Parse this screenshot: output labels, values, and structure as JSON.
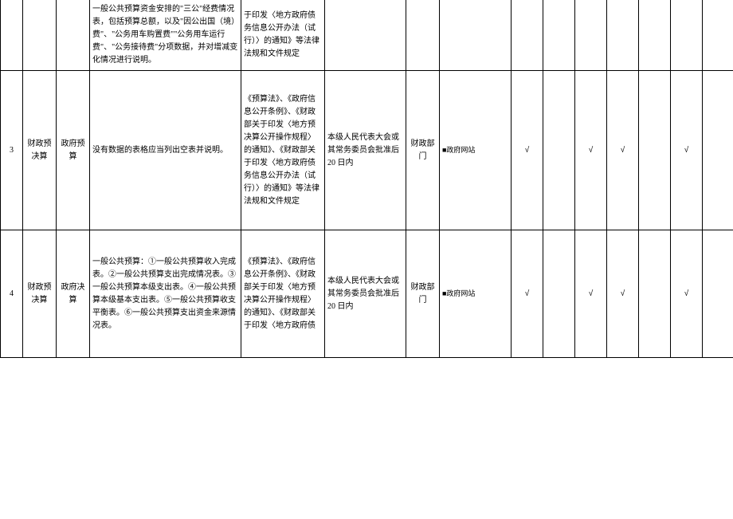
{
  "rows": [
    {
      "num": "",
      "category": "",
      "subcategory": "",
      "content": "一般公共预算资金安排的\"三公\"经费情况表，包括预算总额，以及\"因公出国（境）费\"、\"公务用车购置费\"\"公务用车运行费\"、\"公务接待费\"分项数据，并对增减变化情况进行说明。",
      "basis": "于印发〈地方政府债务信息公开办法（试行）〉的通知》等法律法规和文件规定",
      "time": "",
      "dept": "",
      "channel": "",
      "checks": [
        "",
        "",
        "",
        "",
        "",
        "",
        ""
      ]
    },
    {
      "num": "3",
      "category": "财政预决算",
      "subcategory": "政府预算",
      "content": "没有数据的表格应当列出空表并说明。",
      "basis": "《预算法》、《政府信息公开条例》、《财政部关于印发〈地方预决算公开操作规程〉的通知》、《财政部关于印发〈地方政府债务信息公开办法（试行）〉的通知》等法律法规和文件规定",
      "time": "本级人民代表大会或其常务委员会批准后 20 日内",
      "dept": "财政部门",
      "channel": "■政府网站",
      "checks": [
        "√",
        "",
        "√",
        "√",
        "",
        "√",
        ""
      ]
    },
    {
      "num": "4",
      "category": "财政预决算",
      "subcategory": "政府决算",
      "content": "一般公共预算：①一般公共预算收入完成表。②一般公共预算支出完成情况表。③一般公共预算本级支出表。④一般公共预算本级基本支出表。⑤一般公共预算收支平衡表。⑥一般公共预算支出资金来源情况表。",
      "basis": "《预算法》、《政府信息公开条例》、《财政部关于印发〈地方预决算公开操作规程〉的通知》、《财政部关于印发〈地方政府债",
      "time": "本级人民代表大会或其常务委员会批准后 20 日内",
      "dept": "财政部门",
      "channel": "■政府网站",
      "checks": [
        "√",
        "",
        "√",
        "√",
        "",
        "√",
        ""
      ]
    }
  ]
}
